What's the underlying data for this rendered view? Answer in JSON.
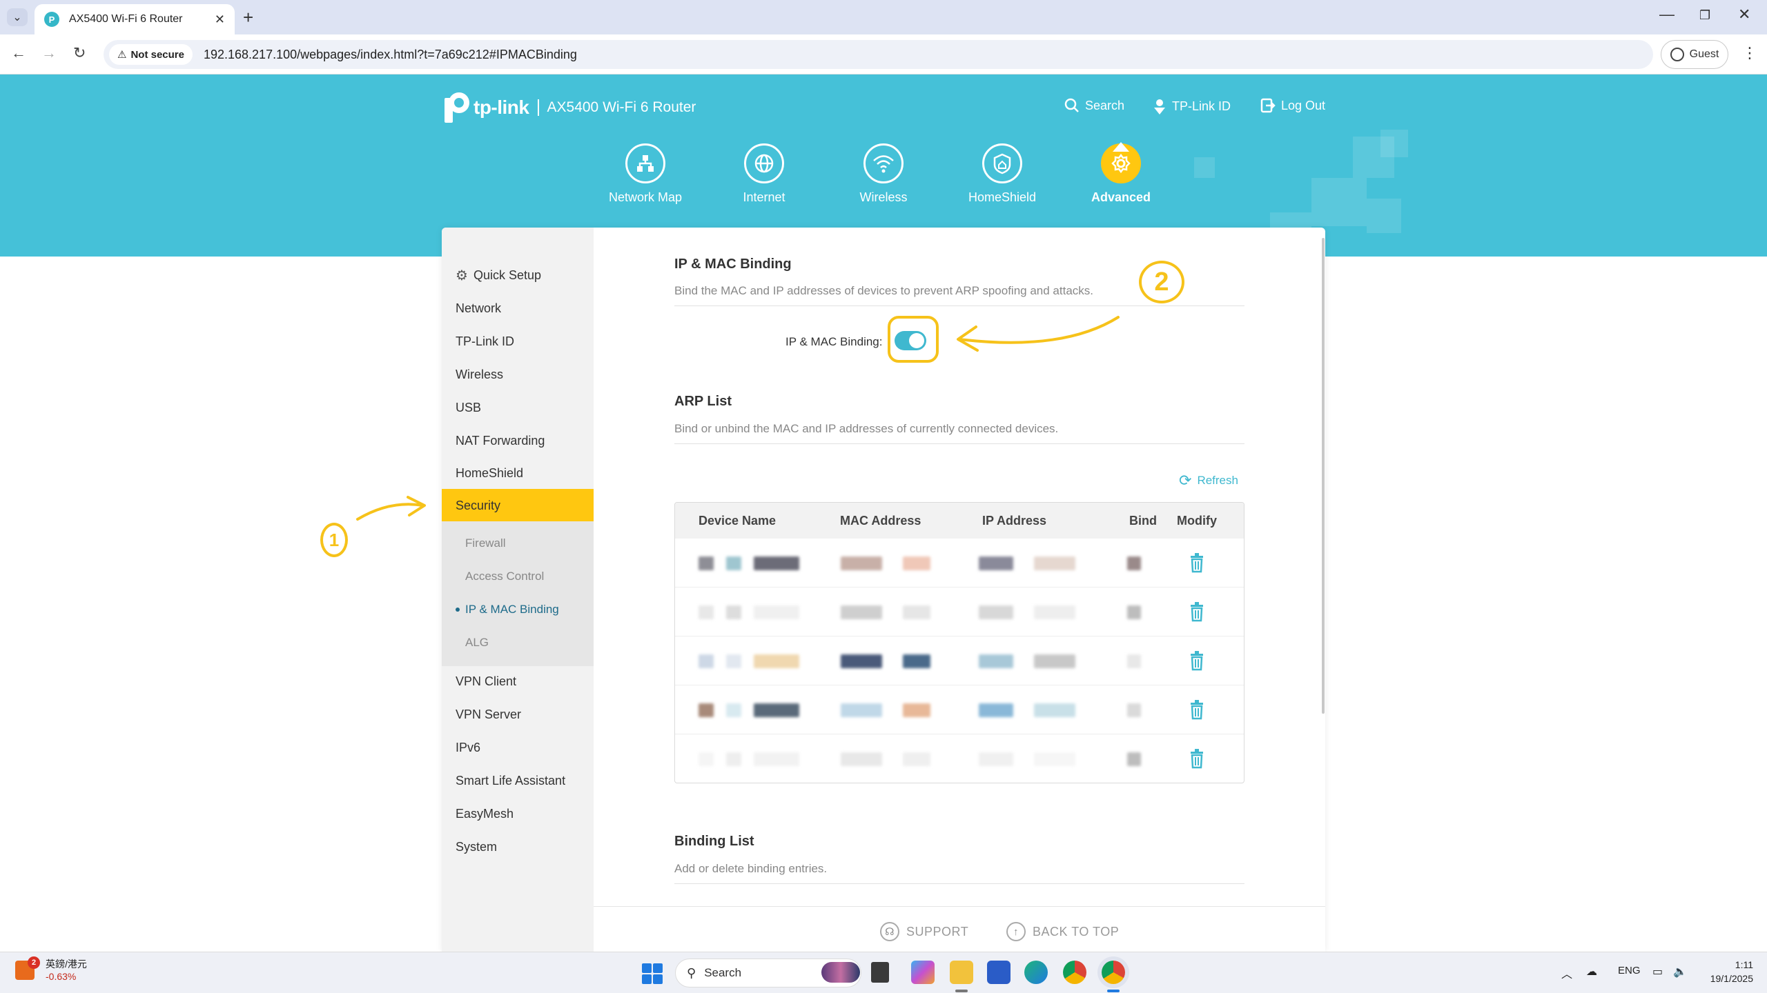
{
  "browser": {
    "tab_title": "AX5400 Wi-Fi 6 Router",
    "security_label": "Not secure",
    "url": "192.168.217.100/webpages/index.html?t=7a69c212#IPMACBinding",
    "profile_label": "Guest"
  },
  "router": {
    "brand": "tp-link",
    "model": "AX5400 Wi-Fi 6 Router",
    "header_links": {
      "search": "Search",
      "tplink_id": "TP-Link ID",
      "logout": "Log Out"
    },
    "nav": [
      {
        "label": "Network Map",
        "icon": "network-map-icon"
      },
      {
        "label": "Internet",
        "icon": "globe-icon"
      },
      {
        "label": "Wireless",
        "icon": "wifi-icon"
      },
      {
        "label": "HomeShield",
        "icon": "home-shield-icon"
      },
      {
        "label": "Advanced",
        "icon": "gear-icon",
        "active": true
      }
    ]
  },
  "sidebar": {
    "items": [
      {
        "label": "Quick Setup"
      },
      {
        "label": "Network"
      },
      {
        "label": "TP-Link ID"
      },
      {
        "label": "Wireless"
      },
      {
        "label": "USB"
      },
      {
        "label": "NAT Forwarding"
      },
      {
        "label": "HomeShield"
      },
      {
        "label": "Security",
        "active": true
      },
      {
        "label": "VPN Client"
      },
      {
        "label": "VPN Server"
      },
      {
        "label": "IPv6"
      },
      {
        "label": "Smart Life Assistant"
      },
      {
        "label": "EasyMesh"
      },
      {
        "label": "System"
      }
    ],
    "security_sub": [
      {
        "label": "Firewall"
      },
      {
        "label": "Access Control"
      },
      {
        "label": "IP & MAC Binding",
        "active": true
      },
      {
        "label": "ALG"
      }
    ]
  },
  "main": {
    "binding_section": {
      "title": "IP & MAC Binding",
      "description": "Bind the MAC and IP addresses of devices to prevent ARP spoofing and attacks.",
      "toggle_label": "IP & MAC Binding:",
      "toggle_on": true
    },
    "arp_section": {
      "title": "ARP List",
      "description": "Bind or unbind the MAC and IP addresses of currently connected devices.",
      "refresh_label": "Refresh",
      "columns": [
        "Device Name",
        "MAC Address",
        "IP Address",
        "Bind",
        "Modify"
      ],
      "row_count": 5
    },
    "binding_list_section": {
      "title": "Binding List",
      "description": "Add or delete binding entries."
    }
  },
  "footer": {
    "support": "SUPPORT",
    "back_to_top": "BACK TO TOP"
  },
  "annotations": {
    "marker_1": "1",
    "marker_2": "2"
  },
  "taskbar": {
    "stock_name": "英鎊/港元",
    "stock_change": "-0.63%",
    "stock_badge": "2",
    "search_label": "Search",
    "language": "ENG",
    "time": "1:11",
    "date": "19/1/2025"
  },
  "colors": {
    "accent": "#45c1d8",
    "active": "#ffc710",
    "annotation": "#f6c21a"
  }
}
